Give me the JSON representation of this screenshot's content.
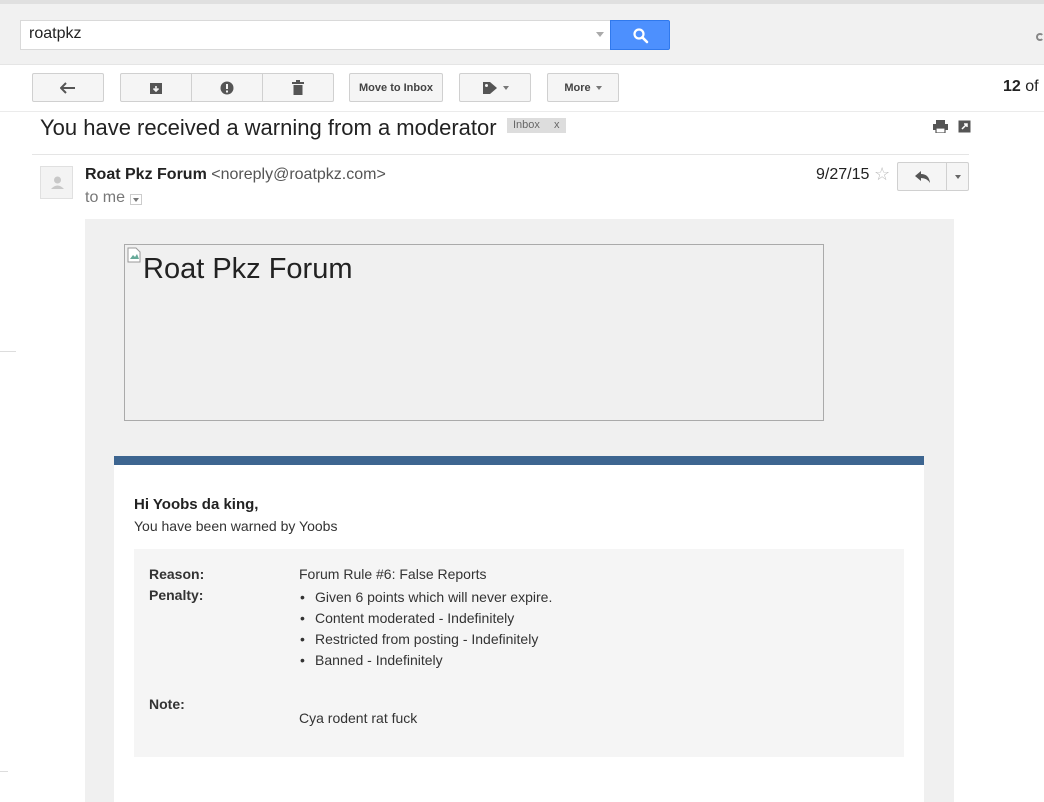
{
  "search": {
    "query": "roatpkz"
  },
  "toolbar": {
    "move_to_inbox": "Move to Inbox",
    "more": "More",
    "count_current": "12",
    "count_of": "of"
  },
  "message": {
    "subject": "You have received a warning from a moderator",
    "label": "Inbox",
    "label_close": "x",
    "sender_name": "Roat Pkz Forum",
    "sender_email": "<noreply@roatpkz.com>",
    "recipient": "to me",
    "date": "9/27/15"
  },
  "body": {
    "header_image_alt": "Roat Pkz Forum",
    "greeting": "Hi Yoobs da king,",
    "warned_by": "You have been warned by Yoobs",
    "reason_label": "Reason:",
    "reason_value": "Forum Rule #6: False Reports",
    "penalty_label": "Penalty:",
    "penalties": [
      "Given 6 points which will never expire.",
      "Content moderated - Indefinitely",
      "Restricted from posting - Indefinitely",
      "Banned - Indefinitely"
    ],
    "note_label": "Note:",
    "note_value": "Cya rodent rat fuck"
  },
  "colors": {
    "search_button": "#4d90fe",
    "card_accent": "#3d6590",
    "label_chip": "#dddddd"
  }
}
